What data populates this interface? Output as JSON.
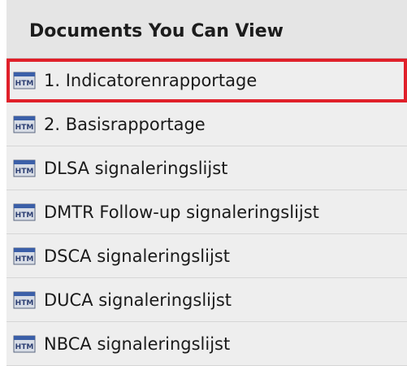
{
  "panel": {
    "title": "Documents You Can View"
  },
  "documents": [
    {
      "label": "1. Indicatorenrapportage",
      "icon": "html-document-icon",
      "selected": true
    },
    {
      "label": "2. Basisrapportage",
      "icon": "html-document-icon",
      "selected": false
    },
    {
      "label": "DLSA signaleringslijst",
      "icon": "html-document-icon",
      "selected": false
    },
    {
      "label": "DMTR Follow-up signaleringslijst",
      "icon": "html-document-icon",
      "selected": false
    },
    {
      "label": "DSCA signaleringslijst",
      "icon": "html-document-icon",
      "selected": false
    },
    {
      "label": "DUCA signaleringslijst",
      "icon": "html-document-icon",
      "selected": false
    },
    {
      "label": "NBCA signaleringslijst",
      "icon": "html-document-icon",
      "selected": false
    }
  ],
  "colors": {
    "selection_outline": "#e0202a",
    "row_background": "#eeeeee",
    "header_background": "#e5e5e5"
  }
}
